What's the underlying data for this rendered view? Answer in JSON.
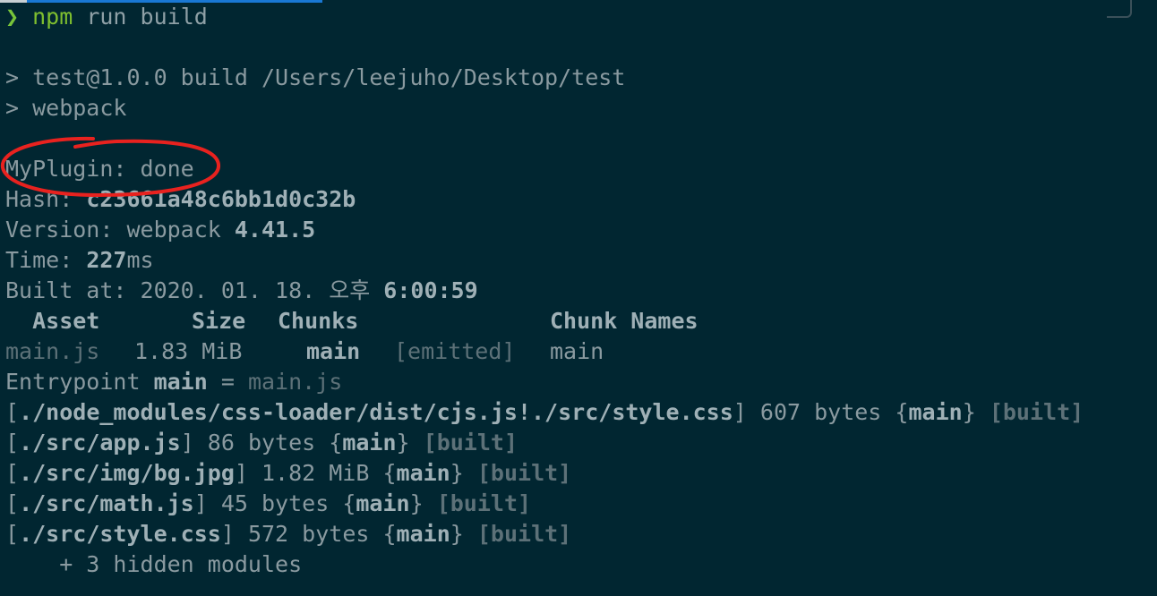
{
  "prompt": {
    "symbol": "❯",
    "command_npm": "npm",
    "command_rest": " run build"
  },
  "lines": {
    "build_header": "> test@1.0.0 build /Users/leejuho/Desktop/test",
    "webpack_header": "> webpack",
    "plugin": "MyPlugin: done",
    "hash_label": "Hash: ",
    "hash_value": "c23661a48c6bb1d0c32b",
    "version_label": "Version: webpack ",
    "version_value": "4.41.5",
    "time_label": "Time: ",
    "time_value": "227",
    "time_unit": "ms",
    "built_label": "Built at: 2020. 01. 18. 오후 ",
    "built_value": "6:00:59"
  },
  "asset_table": {
    "headers": {
      "asset": "  Asset",
      "size": "Size",
      "chunks": "Chunks",
      "chunk_names": "Chunk Names"
    },
    "row": {
      "asset": "main.js",
      "size": "1.83 MiB",
      "chunks": "main",
      "emitted": "[emitted]",
      "names": "main"
    }
  },
  "entrypoint": {
    "label": "Entrypoint ",
    "name": "main",
    "eq": " = ",
    "file": "main.js"
  },
  "modules": [
    {
      "path": "./node_modules/css-loader/dist/cjs.js!./src/style.css",
      "size": " 607 bytes ",
      "chunk": "main",
      "status": "[built]"
    },
    {
      "path": "./src/app.js",
      "size": " 86 bytes ",
      "chunk": "main",
      "status": "[built]"
    },
    {
      "path": "./src/img/bg.jpg",
      "size": " 1.82 MiB ",
      "chunk": "main",
      "status": "[built]"
    },
    {
      "path": "./src/math.js",
      "size": " 45 bytes ",
      "chunk": "main",
      "status": "[built]"
    },
    {
      "path": "./src/style.css",
      "size": " 572 bytes ",
      "chunk": "main",
      "status": "[built]"
    }
  ],
  "hidden_modules": "    + 3 hidden modules",
  "colors": {
    "background": "#012631",
    "prompt": "#78c43a",
    "annotation": "#e8221f"
  }
}
